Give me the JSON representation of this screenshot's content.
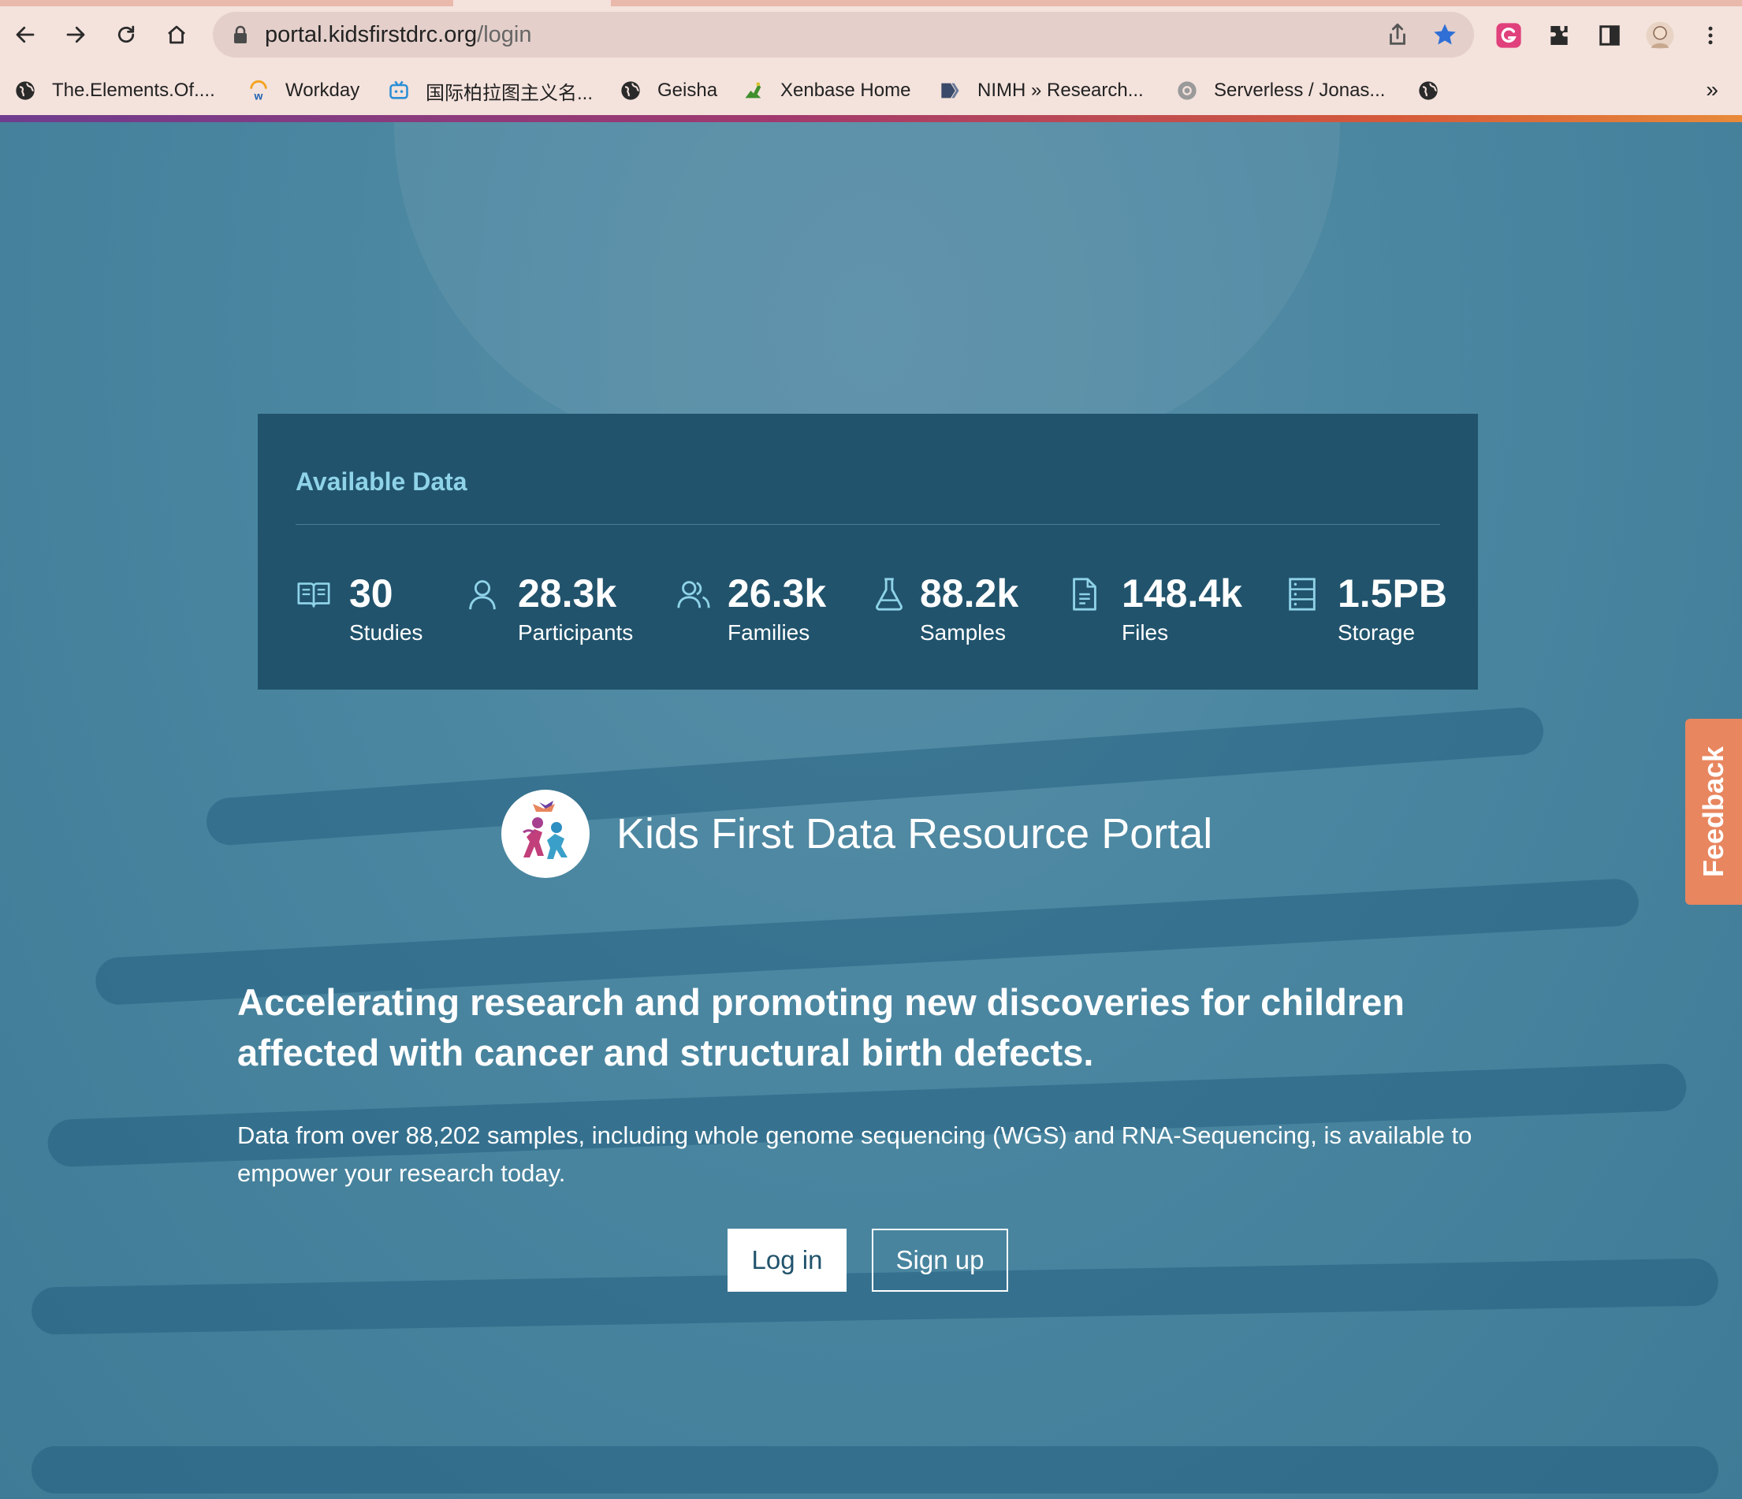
{
  "browser": {
    "url_host": "portal.kidsfirstdrc.org",
    "url_path": "/login",
    "bookmarks": [
      {
        "label": "The.Elements.Of....",
        "icon": "globe-icon"
      },
      {
        "label": "Workday",
        "icon": "workday-icon"
      },
      {
        "label": "国际柏拉图主义名...",
        "icon": "bilibili-icon"
      },
      {
        "label": "Geisha",
        "icon": "globe-icon"
      },
      {
        "label": "Xenbase Home",
        "icon": "xenbase-frog-icon"
      },
      {
        "label": "NIMH » Research...",
        "icon": "nimh-icon"
      },
      {
        "label": "Serverless / Jonas...",
        "icon": "serverless-icon"
      }
    ],
    "bookmarks_overflow": "»"
  },
  "stats": {
    "title": "Available Data",
    "items": [
      {
        "value": "30",
        "label": "Studies",
        "icon": "book-icon"
      },
      {
        "value": "28.3k",
        "label": "Participants",
        "icon": "person-icon"
      },
      {
        "value": "26.3k",
        "label": "Families",
        "icon": "family-icon"
      },
      {
        "value": "88.2k",
        "label": "Samples",
        "icon": "flask-icon"
      },
      {
        "value": "148.4k",
        "label": "Files",
        "icon": "file-icon"
      },
      {
        "value": "1.5PB",
        "label": "Storage",
        "icon": "storage-icon"
      }
    ]
  },
  "brand": {
    "name": "Kids First Data Resource Portal"
  },
  "hero": {
    "headline": "Accelerating research and promoting new discoveries for children affected with cancer and structural birth defects.",
    "description": "Data from over 88,202 samples, including whole genome sequencing (WGS) and RNA-Sequencing, is available to empower your research today."
  },
  "actions": {
    "login_label": "Log in",
    "signup_label": "Sign up"
  },
  "feedback": {
    "label": "Feedback"
  },
  "colors": {
    "card": "#21536c",
    "accent": "#8fd3e8",
    "feedback": "#e8865f"
  }
}
